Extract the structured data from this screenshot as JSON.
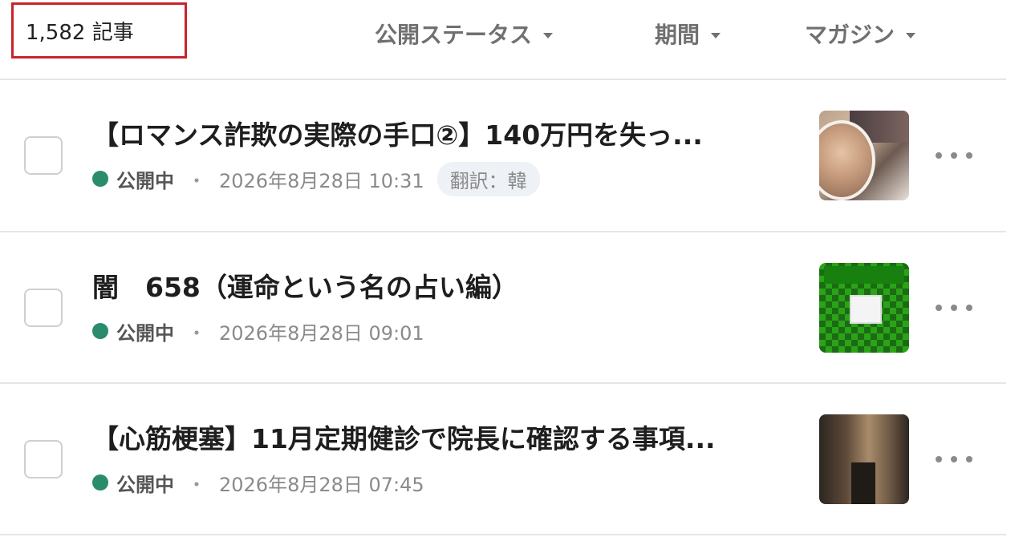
{
  "header": {
    "article_count": "1,582 記事",
    "filters": [
      {
        "label": "公開ステータス"
      },
      {
        "label": "期間"
      },
      {
        "label": "マガジン"
      }
    ]
  },
  "articles": [
    {
      "title": "【ロマンス詐欺の実際の手口②】140万円を失っ...",
      "status": "公開中",
      "separator": "・",
      "date": "2026年8月28日 10:31",
      "tag": "翻訳：韓"
    },
    {
      "title": "闇　658（運命という名の占い編）",
      "status": "公開中",
      "separator": "・",
      "date": "2026年8月28日 09:01"
    },
    {
      "title": "【心筋梗塞】11月定期健診で院長に確認する事項...",
      "status": "公開中",
      "separator": "・",
      "date": "2026年8月28日 07:45"
    }
  ],
  "colors": {
    "highlight_border": "#c8242b",
    "status_published": "#2a8c6c"
  },
  "icons": {
    "filter_caret": "caret-down-icon",
    "row_menu": "more-horizontal-icon"
  }
}
